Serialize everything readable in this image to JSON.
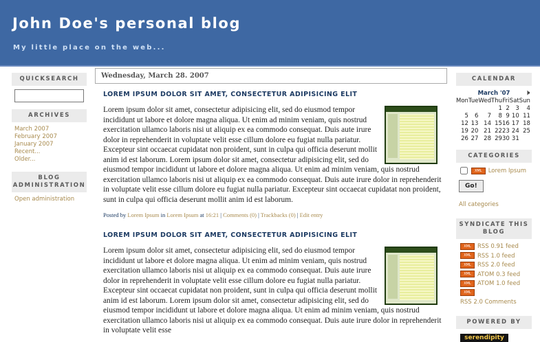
{
  "header": {
    "title": "John Doe's personal blog",
    "description": "My little place on the web..."
  },
  "left_sidebar": {
    "quicksearch": {
      "heading": "QUICKSEARCH",
      "placeholder": ""
    },
    "archives": {
      "heading": "ARCHIVES",
      "items": [
        "March 2007",
        "February 2007",
        "January 2007",
        "Recent...",
        "Older..."
      ]
    },
    "blog_admin": {
      "heading_line1": "BLOG",
      "heading_line2": "ADMINISTRATION",
      "link": "Open administration"
    }
  },
  "main": {
    "date": "Wednesday, March 28. 2007",
    "entries": [
      {
        "title": "LOREM IPSUM DOLOR SIT AMET, CONSECTETUR ADIPISICING ELIT",
        "body": "Lorem ipsum dolor sit amet, consectetur adipisicing elit, sed do eiusmod tempor incididunt ut labore et dolore magna aliqua. Ut enim ad minim veniam, quis nostrud exercitation ullamco laboris nisi ut aliquip ex ea commodo consequat. Duis aute irure dolor in reprehenderit in voluptate velit esse cillum dolore eu fugiat nulla pariatur. Excepteur sint occaecat cupidatat non proident, sunt in culpa qui officia deserunt mollit anim id est laborum. Lorem ipsum dolor sit amet, consectetur adipisicing elit, sed do eiusmod tempor incididunt ut labore et dolore magna aliqua. Ut enim ad minim veniam, quis nostrud exercitation ullamco laboris nisi ut aliquip ex ea commodo consequat. Duis aute irure dolor in reprehenderit in voluptate velit esse cillum dolore eu fugiat nulla pariatur. Excepteur sint occaecat cupidatat non proident, sunt in culpa qui officia deserunt mollit anim id est laborum.",
        "footer": {
          "posted_by": "Posted by",
          "author": "Lorem Ipsum",
          "in_text": "in",
          "category": "Lorem Ipsum",
          "at_text": "at",
          "time": "16:21",
          "comments": "Comments (0)",
          "trackbacks": "Trackbacks (0)",
          "edit": "Edit entry",
          "sep": "|"
        }
      },
      {
        "title": "LOREM IPSUM DOLOR SIT AMET, CONSECTETUR ADIPISICING ELIT",
        "body": "Lorem ipsum dolor sit amet, consectetur adipisicing elit, sed do eiusmod tempor incididunt ut labore et dolore magna aliqua. Ut enim ad minim veniam, quis nostrud exercitation ullamco laboris nisi ut aliquip ex ea commodo consequat. Duis aute irure dolor in reprehenderit in voluptate velit esse cillum dolore eu fugiat nulla pariatur. Excepteur sint occaecat cupidatat non proident, sunt in culpa qui officia deserunt mollit anim id est laborum. Lorem ipsum dolor sit amet, consectetur adipisicing elit, sed do eiusmod tempor incididunt ut labore et dolore magna aliqua. Ut enim ad minim veniam, quis nostrud exercitation ullamco laboris nisi ut aliquip ex ea commodo consequat. Duis aute irure dolor in reprehenderit in voluptate velit esse"
      }
    ]
  },
  "right_sidebar": {
    "calendar": {
      "heading": "CALENDAR",
      "month": "March '07",
      "next_icon": "speaker-arrow-icon",
      "weekdays": [
        "Mon",
        "Tue",
        "Wed",
        "Thu",
        "Fri",
        "Sat",
        "Sun"
      ],
      "weeks": [
        [
          "",
          "",
          "",
          "1",
          "2",
          "3",
          "4"
        ],
        [
          "5",
          "6",
          "7",
          "8",
          "9",
          "10",
          "11"
        ],
        [
          "12",
          "13",
          "14",
          "15",
          "16",
          "17",
          "18"
        ],
        [
          "19",
          "20",
          "21",
          "22",
          "23",
          "24",
          "25"
        ],
        [
          "26",
          "27",
          "28",
          "29",
          "30",
          "31",
          ""
        ]
      ]
    },
    "categories": {
      "heading": "CATEGORIES",
      "items": [
        {
          "label": "Lorem Ipsum",
          "badge": "XML"
        }
      ],
      "go_label": "Go!",
      "all_label": "All categories"
    },
    "syndicate": {
      "heading_line1": "SYNDICATE THIS",
      "heading_line2": "BLOG",
      "feeds": [
        "RSS 0.91 feed",
        "RSS 1.0 feed",
        "RSS 2.0 feed",
        "ATOM 0.3 feed",
        "ATOM 1.0 feed"
      ],
      "badge_label": "XML",
      "comments_feed": "RSS 2.0 Comments"
    },
    "powered": {
      "heading": "POWERED BY",
      "badge": "serendipity"
    }
  },
  "colors": {
    "header_bg": "#3e68a3",
    "link": "#a88a4d",
    "title": "#1d3b63",
    "rss_badge": "#e0641b"
  }
}
